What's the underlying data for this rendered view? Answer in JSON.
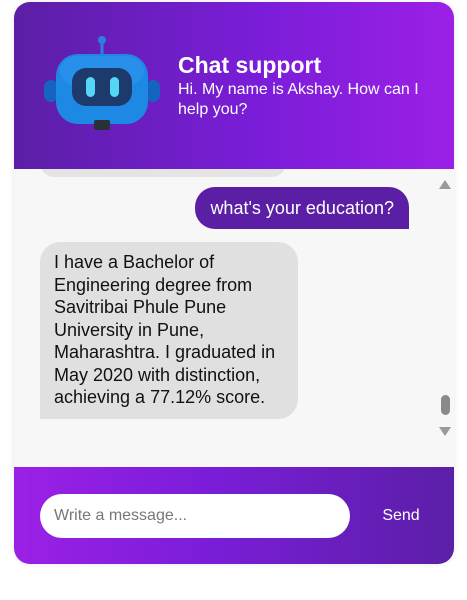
{
  "header": {
    "title": "Chat support",
    "subtitle": "Hi. My name is Akshay. How can I help you?",
    "avatar_icon": "robot-icon"
  },
  "messages": [
    {
      "sender": "user",
      "text": "what's your education?"
    },
    {
      "sender": "bot",
      "text": "I have a Bachelor of Engineering degree from Savitribai Phule Pune University in Pune, Maharashtra. I graduated in May 2020 with distinction, achieving a 77.12% score."
    }
  ],
  "composer": {
    "placeholder": "Write a message...",
    "value": "",
    "send_label": "Send"
  },
  "colors": {
    "accent_dark": "#5b1fa6",
    "accent_light": "#9b20e6",
    "bot_bubble": "#e0e0e0",
    "robot_blue": "#1e88e5"
  }
}
